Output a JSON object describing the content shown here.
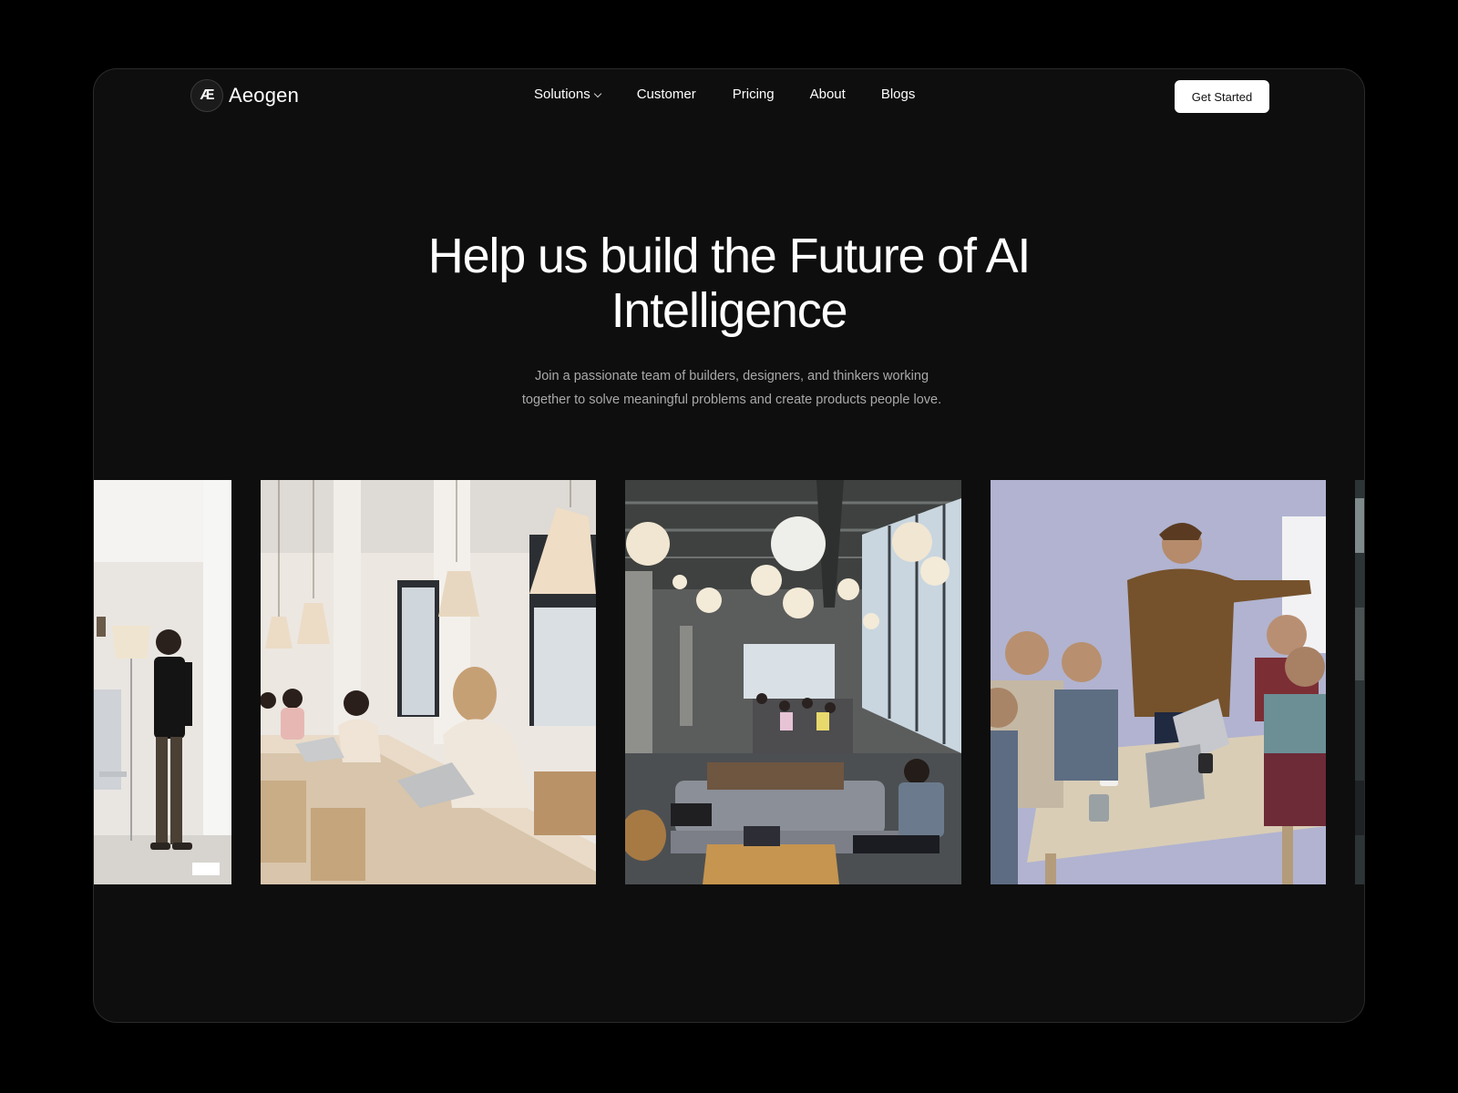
{
  "brand": {
    "logo_mark": "Æ",
    "name": "Aeogen"
  },
  "nav": {
    "solutions": "Solutions",
    "customer": "Customer",
    "pricing": "Pricing",
    "about": "About",
    "blogs": "Blogs"
  },
  "header": {
    "cta_label": "Get Started"
  },
  "hero": {
    "title_line1": "Help us build the Future of AI",
    "title_line2": "Intelligence",
    "subtitle_line1": "Join a passionate team of builders, designers, and thinkers working",
    "subtitle_line2": "together to solve meaningful problems and create products people love."
  },
  "colors": {
    "page_bg": "#000000",
    "frame_bg": "#0e0e0e",
    "text_primary": "#ffffff",
    "text_muted": "#a9a9a9",
    "cta_bg": "#ffffff"
  },
  "icons": {
    "solutions_dropdown": "chevron-down-icon"
  }
}
